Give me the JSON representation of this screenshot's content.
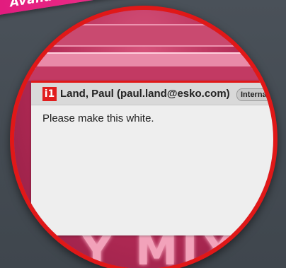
{
  "banner": {
    "text": "Available"
  },
  "comment_card": {
    "app_badge": "i1",
    "author": "Land, Paul (paul.land@esko.com)",
    "tag": "Internal",
    "body": "Please make this white."
  },
  "background_artwork": {
    "text": "Y MIX"
  },
  "colors": {
    "lens_border": "#e01818",
    "banner": "#e0197d",
    "badge": "#e11d1d",
    "page_background": "#4a5159"
  }
}
